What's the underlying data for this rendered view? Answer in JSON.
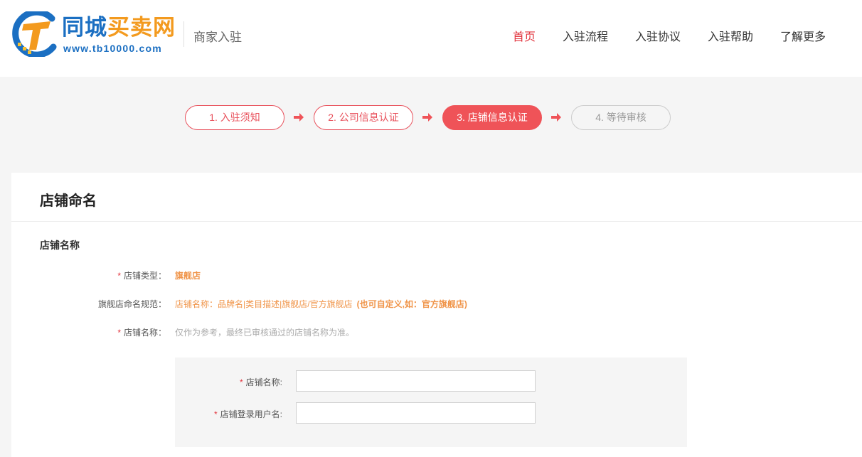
{
  "header": {
    "logo_name_part1": "同城",
    "logo_name_part2": "买卖网",
    "logo_url": "www.tb10000.com",
    "sub_title": "商家入驻",
    "nav": [
      {
        "label": "首页",
        "active": true
      },
      {
        "label": "入驻流程",
        "active": false
      },
      {
        "label": "入驻协议",
        "active": false
      },
      {
        "label": "入驻帮助",
        "active": false
      },
      {
        "label": "了解更多",
        "active": false
      }
    ]
  },
  "steps": [
    {
      "label": "1. 入驻须知",
      "state": "done"
    },
    {
      "label": "2. 公司信息认证",
      "state": "done"
    },
    {
      "label": "3. 店铺信息认证",
      "state": "current"
    },
    {
      "label": "4. 等待审核",
      "state": "pending"
    }
  ],
  "card": {
    "title": "店铺命名",
    "section_title": "店铺名称",
    "rows": {
      "shop_type": {
        "label": "店铺类型：",
        "value": "旗舰店"
      },
      "naming_rule": {
        "label": "旗舰店命名规范：",
        "value": "店铺名称：品牌名|类目描述|旗舰店/官方旗舰店",
        "extra": "(也可自定义,如：官方旗舰店)"
      },
      "shop_name_note": {
        "label": "店铺名称：",
        "value": "仅作为参考，最终已审核通过的店铺名称为准。"
      }
    },
    "form": {
      "shop_name": {
        "label": "店铺名称:",
        "value": "",
        "placeholder": ""
      },
      "login_username": {
        "label": "店铺登录用户名:",
        "value": "",
        "placeholder": ""
      }
    }
  },
  "colors": {
    "accent": "#ef5358",
    "brand_blue": "#1b6fc2",
    "brand_orange": "#f39a1e",
    "highlight_orange": "#f0954a"
  }
}
